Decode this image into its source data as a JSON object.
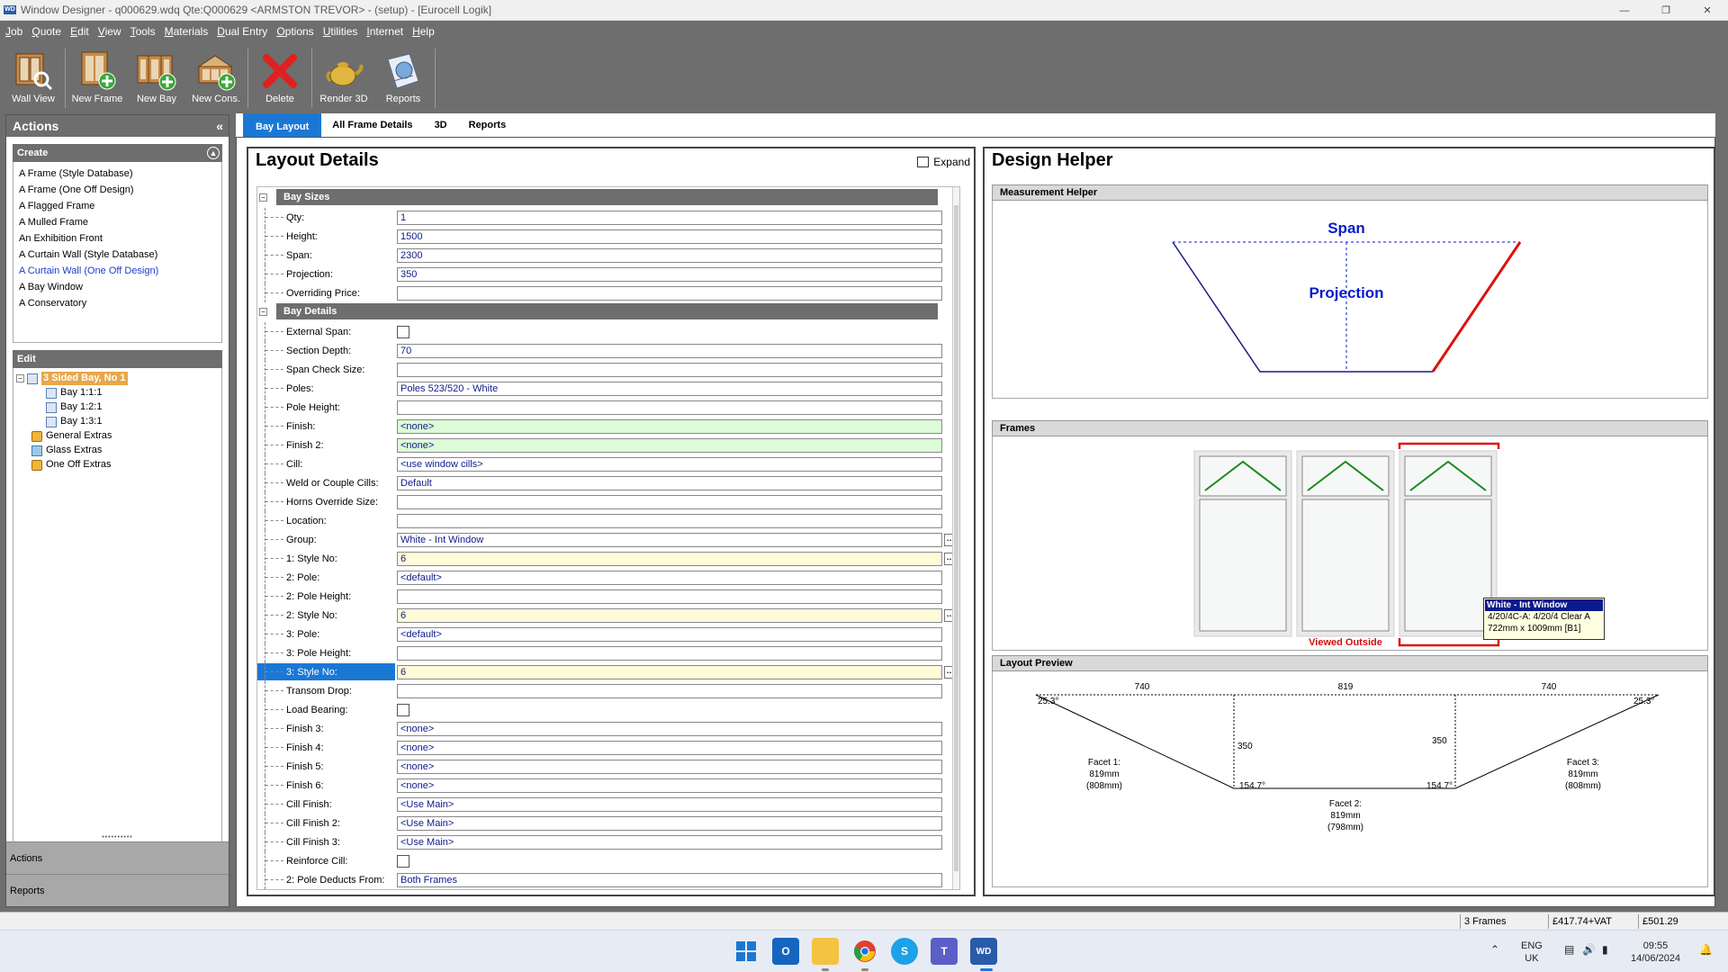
{
  "titlebar": {
    "app_icon": "WD",
    "title": "Window Designer  -  q000629.wdq   Qte:Q000629  <ARMSTON TREVOR>  -  (setup)  -  [Eurocell Logik]"
  },
  "menu": [
    "Job",
    "Quote",
    "Edit",
    "View",
    "Tools",
    "Materials",
    "Dual Entry",
    "Options",
    "Utilities",
    "Internet",
    "Help"
  ],
  "toolbar": {
    "wall_view": "Wall View",
    "new_frame": "New Frame",
    "new_bay": "New Bay",
    "new_cons": "New Cons.",
    "delete": "Delete",
    "render_3d": "Render 3D",
    "reports": "Reports"
  },
  "left": {
    "title": "Actions",
    "collapse": "«",
    "create_title": "Create",
    "create_items": [
      "A Frame (Style Database)",
      "A Frame (One Off Design)",
      "A Flagged Frame",
      "A Mulled Frame",
      "An Exhibition Front",
      "A Curtain Wall (Style Database)",
      "A Curtain Wall (One Off Design)",
      "A Bay Window",
      "A Conservatory"
    ],
    "edit_title": "Edit",
    "tree": {
      "root": "3 Sided Bay, No 1",
      "bay1": "Bay 1:1:1",
      "bay2": "Bay 1:2:1",
      "bay3": "Bay 1:3:1",
      "general_extras": "General Extras",
      "glass_extras": "Glass Extras",
      "one_off_extras": "One Off Extras"
    },
    "nav_actions": "Actions",
    "nav_reports": "Reports"
  },
  "tabs": [
    "Bay Layout",
    "All Frame Details",
    "3D",
    "Reports"
  ],
  "layout": {
    "title": "Layout Details",
    "expand": "Expand",
    "cat_bay_sizes": "Bay Sizes",
    "cat_bay_details": "Bay Details",
    "bay_sizes": [
      {
        "label": "Qty:",
        "value": "1"
      },
      {
        "label": "Height:",
        "value": "1500"
      },
      {
        "label": "Span:",
        "value": "2300"
      },
      {
        "label": "Projection:",
        "value": "350"
      },
      {
        "label": "Overriding Price:",
        "value": ""
      }
    ],
    "bay_details": [
      {
        "label": "External Span:",
        "value": ""
      },
      {
        "label": "Section Depth:",
        "value": "70"
      },
      {
        "label": "Span Check Size:",
        "value": ""
      },
      {
        "label": "Poles:",
        "value": "Poles 523/520 - White"
      },
      {
        "label": "Pole Height:",
        "value": ""
      },
      {
        "label": "Finish:",
        "value": "<none>"
      },
      {
        "label": "Finish 2:",
        "value": "<none>"
      },
      {
        "label": "Cill:",
        "value": "<use window cills>"
      },
      {
        "label": "Weld or Couple Cills:",
        "value": "Default"
      },
      {
        "label": "Horns Override Size:",
        "value": ""
      },
      {
        "label": "Location:",
        "value": ""
      },
      {
        "label": "Group:",
        "value": "White  -  Int Window"
      },
      {
        "label": "1: Style No:",
        "value": "6"
      },
      {
        "label": "2: Pole:",
        "value": "<default>"
      },
      {
        "label": "2: Pole Height:",
        "value": ""
      },
      {
        "label": "2: Style No:",
        "value": "6"
      },
      {
        "label": "3: Pole:",
        "value": "<default>"
      },
      {
        "label": "3: Pole Height:",
        "value": ""
      },
      {
        "label": "3: Style No:",
        "value": "6"
      },
      {
        "label": "Transom Drop:",
        "value": ""
      },
      {
        "label": "Load Bearing:",
        "value": ""
      },
      {
        "label": "Finish 3:",
        "value": "<none>"
      },
      {
        "label": "Finish 4:",
        "value": "<none>"
      },
      {
        "label": "Finish 5:",
        "value": "<none>"
      },
      {
        "label": "Finish 6:",
        "value": "<none>"
      },
      {
        "label": "Cill Finish:",
        "value": "<Use Main>"
      },
      {
        "label": "Cill Finish 2:",
        "value": "<Use Main>"
      },
      {
        "label": "Cill Finish 3:",
        "value": "<Use Main>"
      },
      {
        "label": "Reinforce Cill:",
        "value": ""
      },
      {
        "label": "2: Pole Deducts From:",
        "value": "Both Frames"
      }
    ]
  },
  "helper": {
    "title": "Design Helper",
    "measurement_head": "Measurement Helper",
    "span_label": "Span",
    "projection_label": "Projection",
    "frames_head": "Frames",
    "viewed_outside": "Viewed Outside",
    "preview_head": "Layout Preview",
    "preview": {
      "w_left": "740",
      "w_mid": "819",
      "w_right": "740",
      "angle_l": "25.3°",
      "angle_r": "25.3°",
      "proj_l": "350",
      "proj_r": "350",
      "ang_bl": "154.7°",
      "ang_br": "154.7°",
      "facet1": [
        "Facet 1:",
        "819mm",
        "(808mm)"
      ],
      "facet2": [
        "Facet 2:",
        "819mm",
        "(798mm)"
      ],
      "facet3": [
        "Facet 3:",
        "819mm",
        "(808mm)"
      ]
    },
    "tooltip": {
      "head": "White  -  Int Window",
      "line1": "4/20/4C-A: 4/20/4 Clear A",
      "line2": "722mm x 1009mm [B1]"
    }
  },
  "status": {
    "frames": "3 Frames",
    "price_vat": "£417.74+VAT",
    "price_total": "£501.29"
  },
  "taskbar": {
    "lang_line1": "ENG",
    "lang_line2": "UK",
    "time": "09:55",
    "date": "14/06/2024",
    "wd_icon": "WD"
  },
  "colors": {
    "accent": "#1a78d4",
    "gray_ui": "#6e6e6e",
    "span_blue": "#0a1acc",
    "red_selection": "#e01010",
    "glazing_green": "#1a8a1a"
  }
}
